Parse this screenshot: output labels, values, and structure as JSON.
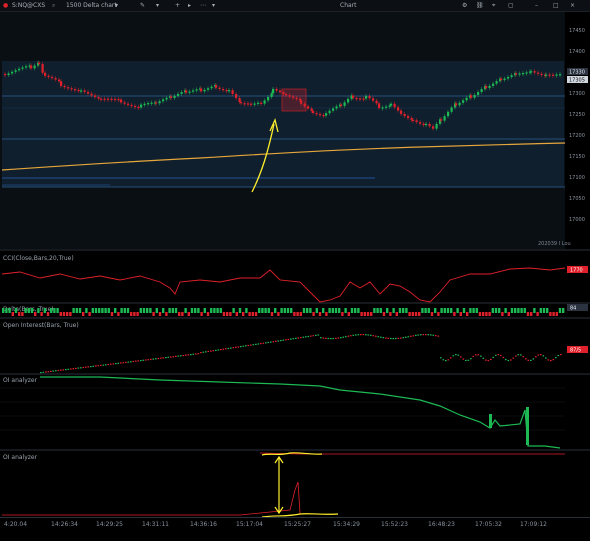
{
  "toolbar": {
    "symbol": "S:NQ@CXS",
    "chart_type": "1500 Delta chart",
    "window_title": "Chart",
    "icons": [
      "search-icon",
      "pencil-icon",
      "crosshair-icon",
      "arrow-right-icon",
      "settings-icon",
      "link-icon",
      "minimize-icon",
      "maximize-icon",
      "close-icon"
    ]
  },
  "price_axis": {
    "labels": [
      "17450",
      "17400",
      "17350",
      "17300",
      "17250",
      "17200",
      "17150",
      "17100",
      "17050",
      "17000"
    ],
    "badges": [
      "17330",
      "17305"
    ],
    "footer": "202039 I Lou"
  },
  "panels": [
    {
      "title": "CCI(Close,Bars,20,True)",
      "badge": "1770"
    },
    {
      "title": "Delta(Bars, True)",
      "badge": "84"
    },
    {
      "title": "Open Interest(Bars, True)",
      "badge": "87/5"
    },
    {
      "title": "OI analyzer",
      "badge": ""
    },
    {
      "title": "OI analyzer",
      "badge": ""
    }
  ],
  "time_axis": [
    "4:20.04",
    "14:26:34",
    "14:29:25",
    "14:31:11",
    "14:36:16",
    "15:17:04",
    "15:25:27",
    "15:34:29",
    "15:52:23",
    "16:48:23",
    "17:05:32",
    "17:09:12"
  ],
  "colors": {
    "up": "#1db954",
    "down": "#e0212b",
    "highlight": "#ffee2c",
    "panel_bg": "#0e1a24",
    "grid": "#1e3a5a",
    "ma": "#e6a63c"
  }
}
